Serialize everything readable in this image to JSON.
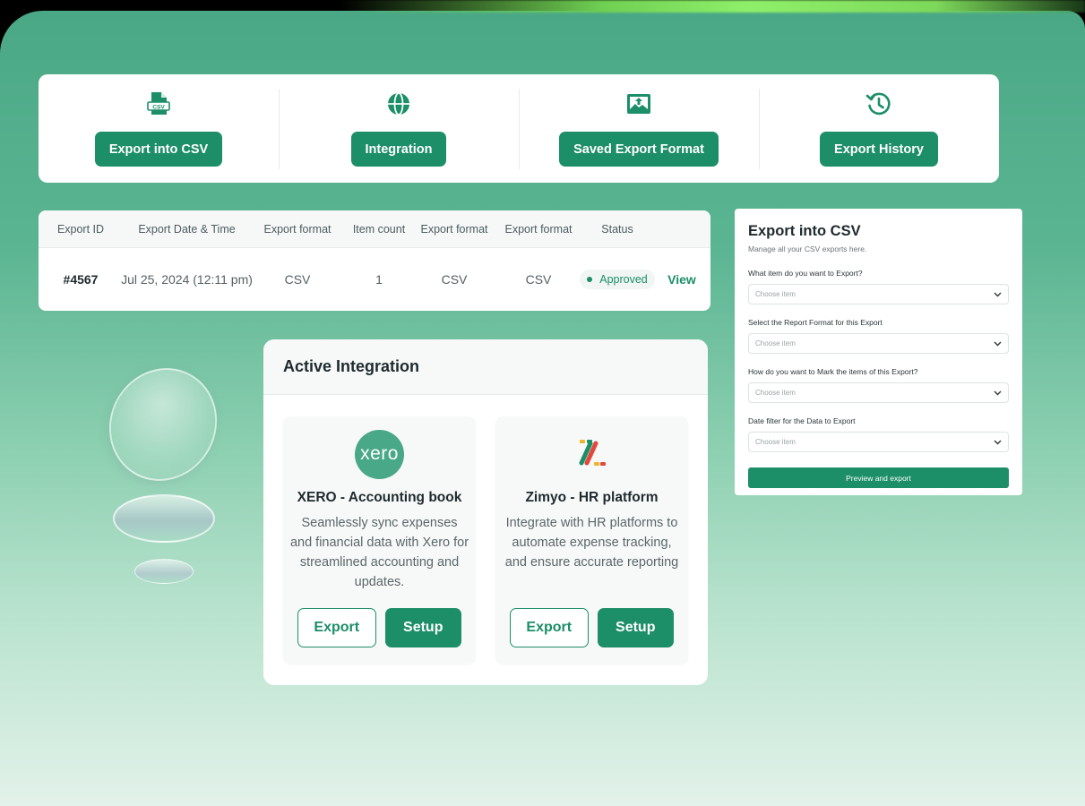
{
  "actions": [
    {
      "label": "Export into CSV",
      "icon": "csv-file-icon"
    },
    {
      "label": "Integration",
      "icon": "globe-icon"
    },
    {
      "label": "Saved Export Format",
      "icon": "image-upload-icon"
    },
    {
      "label": "Export History",
      "icon": "history-icon"
    }
  ],
  "csv_icon_text": "CSV",
  "table": {
    "headers": [
      "Export ID",
      "Export Date & Time",
      "Export format",
      "Item count",
      "Export format",
      "Export format",
      "Status"
    ],
    "rows": [
      {
        "id": "#4567",
        "date": "Jul 25, 2024 (12:11 pm)",
        "format1": "CSV",
        "count": "1",
        "format2": "CSV",
        "format3": "CSV",
        "status": "Approved",
        "action": "View"
      }
    ]
  },
  "integration": {
    "title": "Active Integration",
    "cards": [
      {
        "logo_text": "xero",
        "title": "XERO - Accounting book",
        "desc": "Seamlessly sync expenses and financial data with Xero for streamlined accounting and updates.",
        "export_label": "Export",
        "setup_label": "Setup"
      },
      {
        "title": "Zimyo - HR platform",
        "desc": "Integrate with HR platforms to automate  expense tracking, and ensure accurate reporting",
        "export_label": "Export",
        "setup_label": "Setup"
      }
    ]
  },
  "export_form": {
    "title": "Export into CSV",
    "subtitle": "Manage all your CSV exports here.",
    "fields": [
      {
        "label": "What item do you want to Export?",
        "placeholder": "Choose item"
      },
      {
        "label": "Select the Report Format for this Export",
        "placeholder": "Choose item"
      },
      {
        "label": "How do you want to Mark the items of this Export?",
        "placeholder": "Choose item"
      },
      {
        "label": "Date filter for the Data to Export",
        "placeholder": "Choose item"
      }
    ],
    "submit_label": "Preview and export"
  },
  "colors": {
    "brand": "#1c8e68",
    "background_top": "#4aa886",
    "background_bottom": "#e3f2ea"
  }
}
